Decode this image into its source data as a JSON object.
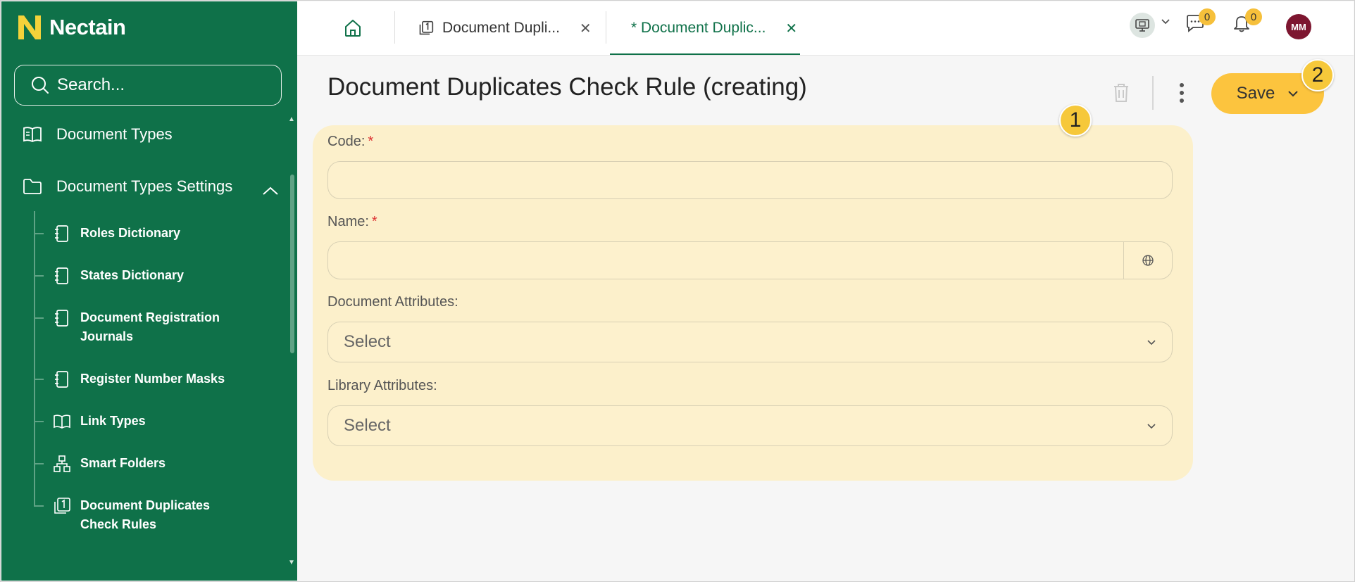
{
  "app": {
    "name": "Nectain"
  },
  "sidebar": {
    "search_placeholder": "Search...",
    "top_item": "Document Types",
    "group": "Document Types Settings",
    "items": [
      {
        "label": "Roles Dictionary",
        "icon": "notebook-icon"
      },
      {
        "label": "States Dictionary",
        "icon": "notebook-icon"
      },
      {
        "label": "Document Registration Journals",
        "icon": "notebook-icon"
      },
      {
        "label": "Register Number Masks",
        "icon": "notebook-icon"
      },
      {
        "label": "Link Types",
        "icon": "book-open-icon"
      },
      {
        "label": "Smart Folders",
        "icon": "hierarchy-icon"
      },
      {
        "label": "Document Duplicates Check Rules",
        "icon": "numbered-doc-icon"
      }
    ]
  },
  "tabs": [
    {
      "label": "Document Dupli...",
      "active": false
    },
    {
      "label": "* Document Duplic...",
      "active": true
    }
  ],
  "header": {
    "chat_count": "0",
    "notif_count": "0",
    "avatar_initials": "MM"
  },
  "page": {
    "title": "Document Duplicates Check Rule (creating)",
    "save_label": "Save",
    "markers": [
      "1",
      "2"
    ]
  },
  "form": {
    "code_label": "Code:",
    "name_label": "Name:",
    "required_mark": "*",
    "doc_attr_label": "Document Attributes:",
    "doc_attr_value": "Select",
    "lib_attr_label": "Library Attributes:",
    "lib_attr_value": "Select"
  },
  "colors": {
    "sidebar": "#0f7149",
    "accent": "#fcc43e",
    "form_bg": "#fcf0cb",
    "avatar": "#7d1630"
  }
}
